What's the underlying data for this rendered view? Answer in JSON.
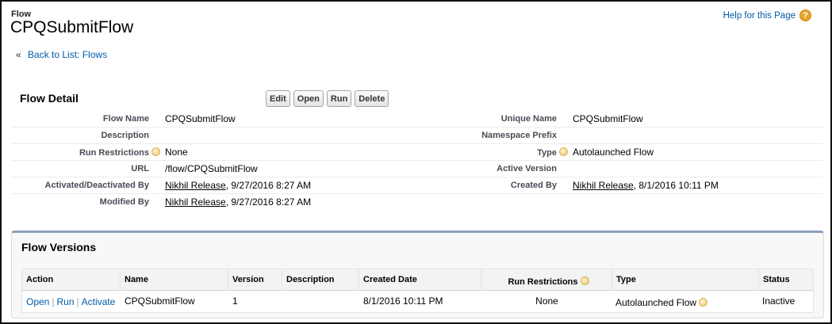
{
  "header": {
    "object_type": "Flow",
    "title": "CPQSubmitFlow",
    "help_link": "Help for this Page",
    "help_icon": "question-circle-icon",
    "back_link": "Back to List: Flows",
    "back_prefix": "«"
  },
  "detail": {
    "section_title": "Flow Detail",
    "buttons": {
      "edit": "Edit",
      "open": "Open",
      "run": "Run",
      "delete": "Delete"
    },
    "fields": {
      "flow_name": {
        "label": "Flow Name",
        "value": "CPQSubmitFlow"
      },
      "unique_name": {
        "label": "Unique Name",
        "value": "CPQSubmitFlow"
      },
      "description": {
        "label": "Description",
        "value": ""
      },
      "namespace_prefix": {
        "label": "Namespace Prefix",
        "value": ""
      },
      "run_restrictions": {
        "label": "Run Restrictions",
        "value": "None"
      },
      "type": {
        "label": "Type",
        "value": "Autolaunched Flow"
      },
      "url": {
        "label": "URL",
        "value": "/flow/CPQSubmitFlow"
      },
      "active_version": {
        "label": "Active Version",
        "value": ""
      },
      "activated_by": {
        "label": "Activated/Deactivated By",
        "user": "Nikhil Release",
        "date": ", 9/27/2016 8:27 AM"
      },
      "created_by": {
        "label": "Created By",
        "user": "Nikhil Release",
        "date": ", 8/1/2016 10:11 PM"
      },
      "modified_by": {
        "label": "Modified By",
        "user": "Nikhil Release",
        "date": ", 9/27/2016 8:27 AM"
      }
    }
  },
  "versions": {
    "section_title": "Flow Versions",
    "columns": {
      "action": "Action",
      "name": "Name",
      "version": "Version",
      "description": "Description",
      "created_date": "Created Date",
      "run_restrictions": "Run Restrictions",
      "type": "Type",
      "status": "Status"
    },
    "rows": [
      {
        "actions": {
          "open": "Open",
          "run": "Run",
          "activate": "Activate",
          "separator": "|"
        },
        "name": "CPQSubmitFlow",
        "version": "1",
        "description": "",
        "created_date": "8/1/2016 10:11 PM",
        "run_restrictions": "None",
        "type": "Autolaunched Flow",
        "status": "Inactive"
      }
    ]
  },
  "colors": {
    "link": "#015ba7",
    "label": "#4a4a56",
    "accent_border": "#8aa0bd",
    "help_icon": "#e6a52a"
  }
}
